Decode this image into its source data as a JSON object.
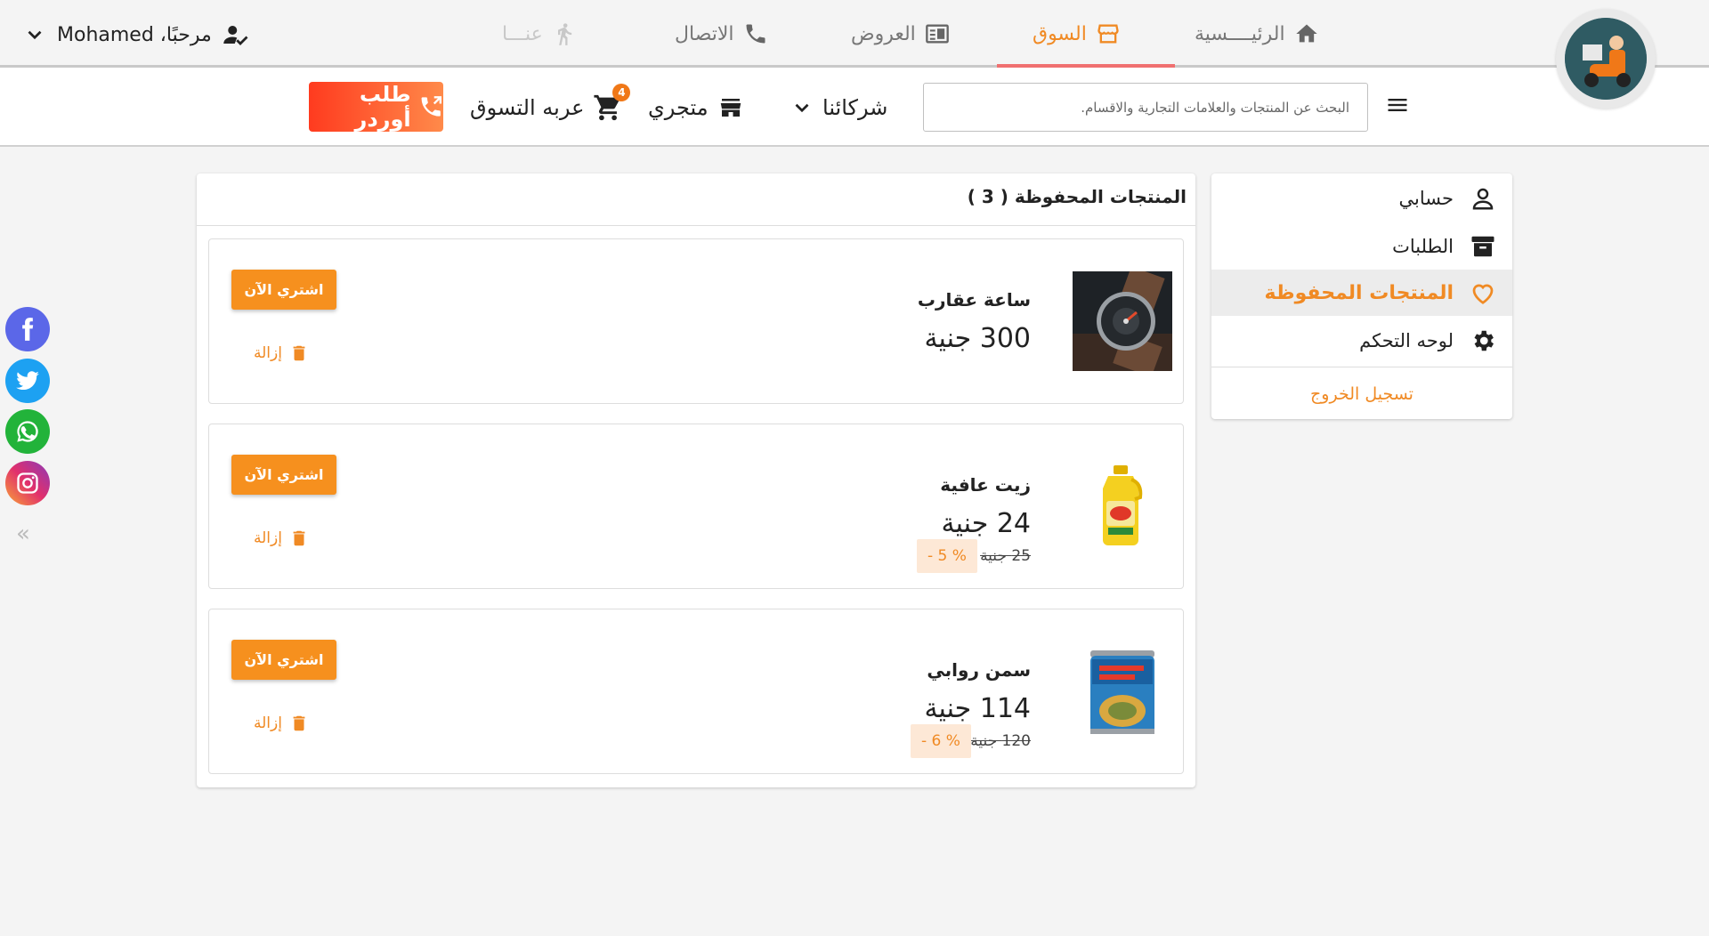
{
  "nav": {
    "items": [
      {
        "label": "الرئيــــسية",
        "icon": "home-icon"
      },
      {
        "label": "السوق",
        "icon": "store-icon"
      },
      {
        "label": "العروض",
        "icon": "newspaper-icon"
      },
      {
        "label": "الاتصال",
        "icon": "phone-icon"
      },
      {
        "label": "عنـــا",
        "icon": "walk-icon"
      }
    ],
    "user_greeting": "مرحبًا، Mohamed"
  },
  "subbar": {
    "search_placeholder": "البحث عن المنتجات والعلامات التجارية والاقسام.",
    "partners_label": "شركائنا",
    "store_label": "متجري",
    "cart_label": "عربه التسوق",
    "cart_count": "4",
    "order_label": "طلب أوردر"
  },
  "sidebar": {
    "items": [
      {
        "label": "حسابي",
        "icon": "user-icon"
      },
      {
        "label": "الطلبات",
        "icon": "archive-icon"
      },
      {
        "label": "المنتجات المحفوظة",
        "icon": "heart-icon"
      },
      {
        "label": "لوحه التحكم",
        "icon": "gear-icon"
      }
    ],
    "logout_label": "تسجيل الخروج"
  },
  "panel": {
    "title": "المنتجات المحفوظة ( 3 )"
  },
  "products": [
    {
      "name": "ساعة عقارب",
      "price": "300 جنية",
      "old_price": "",
      "discount": "",
      "buy_label": "اشتري الآن",
      "remove_label": "إزالة"
    },
    {
      "name": "زيت عافية",
      "price": "24 جنية",
      "old_price": "25 جنية",
      "discount": "% 5 -",
      "buy_label": "اشتري الآن",
      "remove_label": "إزالة"
    },
    {
      "name": "سمن روابي",
      "price": "114 جنية",
      "old_price": "120 جنية",
      "discount": "% 6 -",
      "buy_label": "اشتري الآن",
      "remove_label": "إزالة"
    }
  ],
  "colors": {
    "accent": "#f08a24",
    "button": "#f6901e"
  }
}
